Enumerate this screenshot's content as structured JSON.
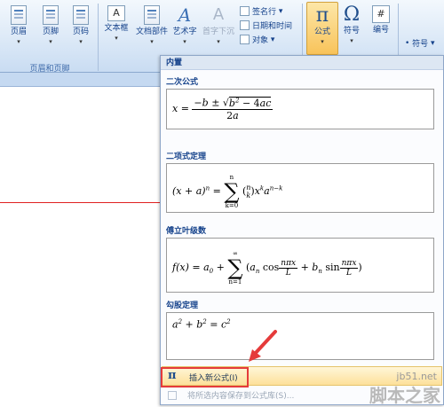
{
  "ribbon": {
    "header_group": {
      "buttons": [
        "页眉",
        "页脚",
        "页码"
      ],
      "label": "页眉和页脚"
    },
    "text_group": {
      "buttons": [
        "文本框",
        "文档部件",
        "艺术字",
        "首字下沉"
      ]
    },
    "small_items": [
      "签名行",
      "日期和时间",
      "对象"
    ],
    "equation_label": "公式",
    "symbol_label": "符号",
    "number_label": "编号",
    "right_symbol_label": "符号"
  },
  "gallery": {
    "header": "内置",
    "sections": [
      {
        "title": "二次公式"
      },
      {
        "title": "二项式定理"
      },
      {
        "title": "傅立叶级数"
      },
      {
        "title": "勾股定理"
      }
    ],
    "insert_new": "插入新公式(I)",
    "save_selection": "将所选内容保存到公式库(S)..."
  },
  "watermark": {
    "site": "jb51.net",
    "brand": "脚本之家"
  }
}
